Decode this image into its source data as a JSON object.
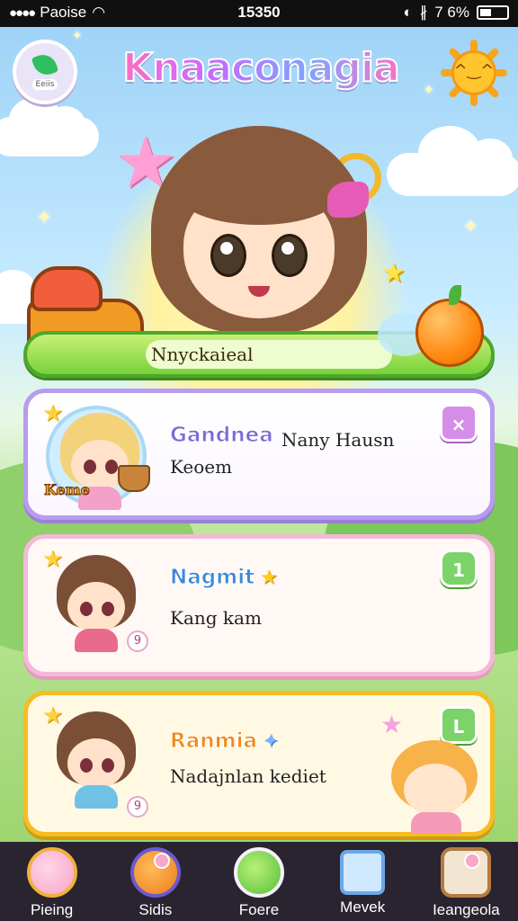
{
  "status_bar": {
    "carrier": "Paoise",
    "time": "15350",
    "battery": "6%",
    "signal_percent": "7"
  },
  "header": {
    "title": "Knaaconagia",
    "badge_label": "Eeiis"
  },
  "hero": {
    "name_bar": "Nnyckaieal"
  },
  "cards": [
    {
      "name": "Gandnea",
      "extra": "Nany Hausn",
      "subtitle": "Keoem",
      "portrait_label": "Keme",
      "button": "×"
    },
    {
      "name": "Nagmit",
      "subtitle": "Kang kam",
      "button": "1",
      "small_badge": "9"
    },
    {
      "name": "Ranmia",
      "subtitle": "Nadajnlan kediet",
      "button": "L",
      "small_badge": "9"
    }
  ],
  "nav": {
    "items": [
      {
        "label": "Pieing"
      },
      {
        "label": "Sidis"
      },
      {
        "label": "Foere"
      },
      {
        "label": "Mevek"
      },
      {
        "label": "Ieangeola"
      }
    ]
  },
  "colors": {
    "accent_pink": "#ff6fc1",
    "accent_green": "#78d23a",
    "accent_gold": "#f5bd22",
    "nav_bg": "#2a2430"
  }
}
